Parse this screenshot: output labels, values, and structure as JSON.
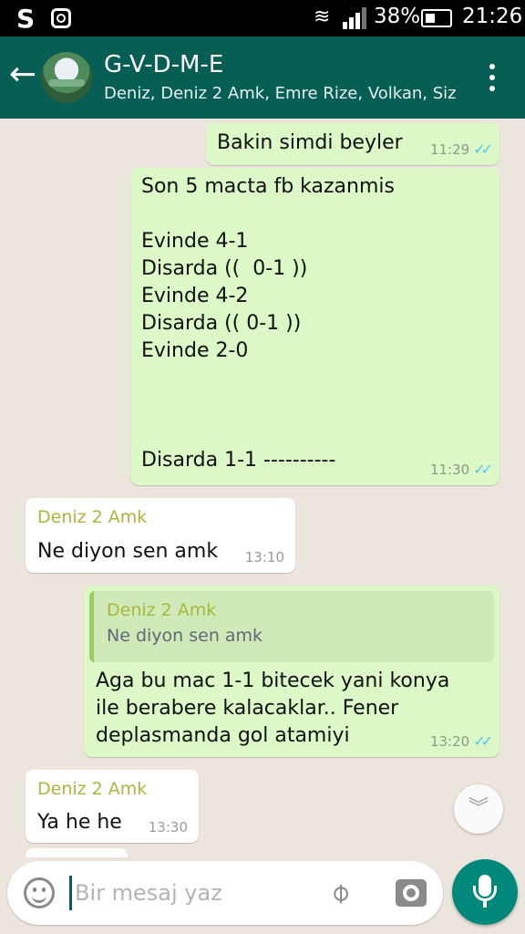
{
  "status_bar": {
    "s_icon": "S",
    "battery": "38%",
    "time": "21:26",
    "icons": [
      "s-app-icon",
      "instagram-icon",
      "wifi-icon",
      "signal-icon",
      "battery-icon"
    ]
  },
  "header": {
    "title": "G-V-D-M-E",
    "members": "Deniz, Deniz 2 Amk, Emre Rize, Volkan, Siz",
    "icons": [
      "back-arrow-icon",
      "group-avatar",
      "more-options-icon"
    ]
  },
  "messages": [
    {
      "id": "m1",
      "type": "out",
      "text": "Bakin simdi beyler",
      "time": "11:29",
      "ticks": "✓✓"
    },
    {
      "id": "m2",
      "type": "out",
      "text": "Son 5 macta fb kazanmis\n\nEvinde 4-1\nDisarda ((  0-1 ))\nEvinde 4-2\nDisarda (( 0-1 ))\nEvinde 2-0\n\n\n\nDisarda 1-1 ----------",
      "time": "11:30",
      "ticks": "✓✓"
    },
    {
      "id": "m3",
      "type": "in",
      "sender": "Deniz 2 Amk",
      "text": "Ne diyon sen amk",
      "time": "13:10"
    },
    {
      "id": "m4",
      "type": "out",
      "quote_sender": "Deniz 2 Amk",
      "quote_text": "Ne diyon sen amk",
      "text": "Aga bu mac 1-1 bitecek yani konya\nile berabere kalacaklar.. Fener\ndeplasmanda gol atamiyi",
      "time": "13:20",
      "ticks": "✓✓"
    },
    {
      "id": "m5",
      "type": "in",
      "sender": "Deniz 2 Amk",
      "text": "Ya he he",
      "time": "13:30"
    }
  ],
  "input": {
    "placeholder": "Bir mesaj yaz",
    "icons": [
      "emoji-icon",
      "attach-icon",
      "camera-icon",
      "mic-icon",
      "scroll-down-icon"
    ]
  },
  "colors": {
    "header": "#075e54",
    "outgoing_bubble": "#dcf8c6",
    "incoming_bubble": "#ffffff",
    "chat_background": "#ece5dd",
    "sender_name": "#a8b93a",
    "read_ticks": "#4fc3f7",
    "mic_button": "#00897b"
  }
}
